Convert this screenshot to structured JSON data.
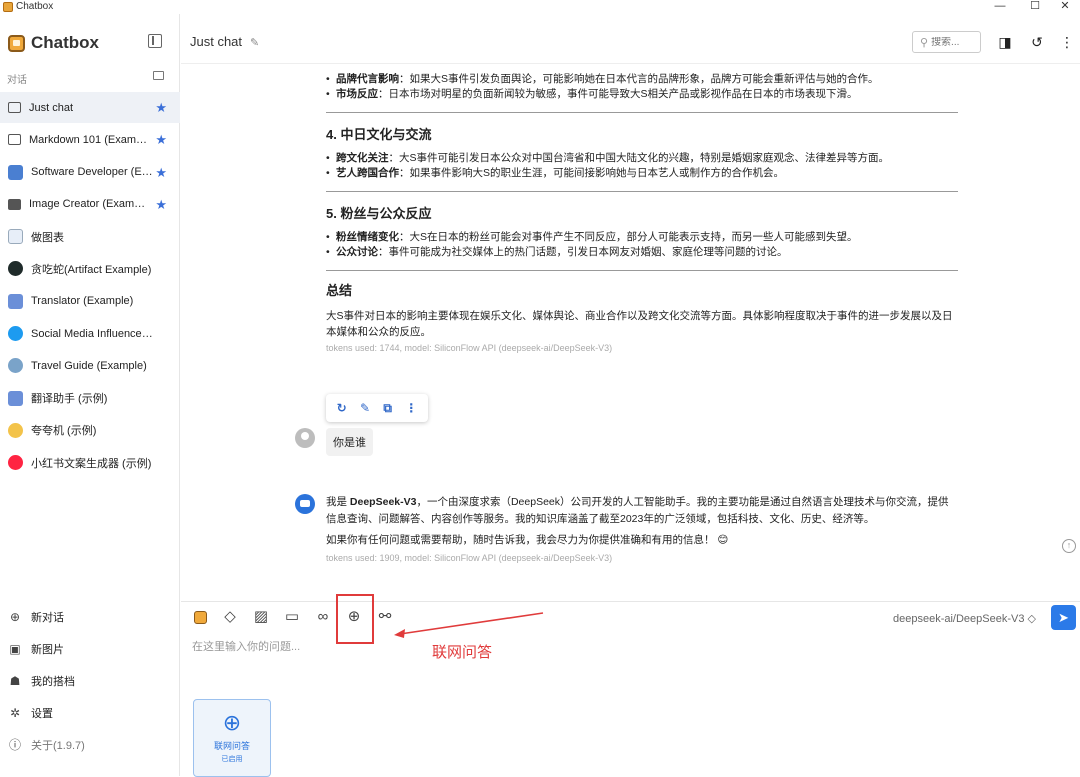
{
  "window": {
    "title": "Chatbox",
    "minimize": "—",
    "maximize": "☐",
    "close": "✕"
  },
  "sidebar": {
    "brand": "Chatbox",
    "section_label": "对话",
    "conversations": [
      {
        "label": "Just chat",
        "icon": "chat-icon",
        "starred": true,
        "active": true
      },
      {
        "label": "Markdown 101 (Example)",
        "icon": "chat-icon",
        "starred": true
      },
      {
        "label": "Software Developer (Example)",
        "icon": "developer-avatar-icon",
        "starred": true
      },
      {
        "label": "Image Creator (Example)",
        "icon": "image-icon",
        "starred": true
      },
      {
        "label": "做图表",
        "icon": "chart-avatar-icon"
      },
      {
        "label": "贪吃蛇(Artifact Example)",
        "icon": "snake-avatar-icon"
      },
      {
        "label": "Translator (Example)",
        "icon": "translator-avatar-icon"
      },
      {
        "label": "Social Media Influencer (Example)",
        "icon": "twitter-avatar-icon"
      },
      {
        "label": "Travel Guide (Example)",
        "icon": "globe-avatar-icon"
      },
      {
        "label": "翻译助手 (示例)",
        "icon": "translator-avatar-icon"
      },
      {
        "label": "夸夸机 (示例)",
        "icon": "sparkle-avatar-icon"
      },
      {
        "label": "小红书文案生成器 (示例)",
        "icon": "xiaohongshu-avatar-icon"
      }
    ],
    "star": "★",
    "bottom": {
      "new_chat": "新对话",
      "new_image": "新图片",
      "my_partners": "我的搭档",
      "settings": "设置",
      "about": "关于(1.9.7)"
    }
  },
  "header": {
    "title": "Just chat",
    "edit_glyph": "✎",
    "search_placeholder": "搜索..."
  },
  "assistant_message_1": {
    "bullets_top": [
      {
        "bold": "品牌代言影响",
        "text": "：如果大S事件引发负面舆论，可能影响她在日本代言的品牌形象，品牌方可能会重新评估与她的合作。"
      },
      {
        "bold": "市场反应",
        "text": "：日本市场对明星的负面新闻较为敏感，事件可能导致大S相关产品或影视作品在日本的市场表现下滑。"
      }
    ],
    "section4_title": "4. 中日文化与交流",
    "section4_bullets": [
      {
        "bold": "跨文化关注",
        "text": "：大S事件可能引发日本公众对中国台湾省和中国大陆文化的兴趣，特别是婚姻家庭观念、法律差异等方面。"
      },
      {
        "bold": "艺人跨国合作",
        "text": "：如果事件影响大S的职业生涯，可能间接影响她与日本艺人或制作方的合作机会。"
      }
    ],
    "section5_title": "5. 粉丝与公众反应",
    "section5_bullets": [
      {
        "bold": "粉丝情绪变化",
        "text": "：大S在日本的粉丝可能会对事件产生不同反应，部分人可能表示支持，而另一些人可能感到失望。"
      },
      {
        "bold": "公众讨论",
        "text": "：事件可能成为社交媒体上的热门话题，引发日本网友对婚姻、家庭伦理等问题的讨论。"
      }
    ],
    "summary_title": "总结",
    "summary_text": "大S事件对日本的影响主要体现在娱乐文化、媒体舆论、商业合作以及跨文化交流等方面。具体影响程度取决于事件的进一步发展以及日本媒体和公众的反应。",
    "meta": "tokens used: 1744, model: SiliconFlow API (deepseek-ai/DeepSeek-V3)"
  },
  "message_actions": {
    "retry": "↻",
    "edit": "✎",
    "copy": "⧉",
    "more": "⋮"
  },
  "user_message": {
    "text": "你是谁"
  },
  "assistant_message_2": {
    "intro_plain": "我是 ",
    "intro_bold": "DeepSeek-V3",
    "intro_rest": "，一个由深度求索（DeepSeek）公司开发的人工智能助手。我的主要功能是通过自然语言处理技术与你交流，提供信息查询、问题解答、内容创作等服务。我的知识库涵盖了截至2023年的广泛领域，包括科技、文化、历史、经济等。",
    "para2": "如果你有任何问题或需要帮助，随时告诉我，我会尽力为你提供准确和有用的信息！ 😊",
    "meta": "tokens used: 1909, model: SiliconFlow API (deepseek-ai/DeepSeek-V3)"
  },
  "scroll_up_glyph": "↑",
  "composer": {
    "tools": [
      "chatbox-icon",
      "eraser-icon",
      "image-upload-icon",
      "folder-icon",
      "link-icon",
      "globe-icon",
      "settings-sliders-icon"
    ],
    "model": "deepseek-ai/DeepSeek-V3 ◇",
    "send_glyph": "➤",
    "input_placeholder": "在这里输入你的问题..."
  },
  "annotation": {
    "label": "联网问答",
    "color": "#e03b3b"
  },
  "web_search_card": {
    "title": "联网问答",
    "subtitle": "已启用"
  },
  "colors": {
    "accent": "#2b73db",
    "annotation": "#e03b3b",
    "active_row": "#eef1f6"
  }
}
